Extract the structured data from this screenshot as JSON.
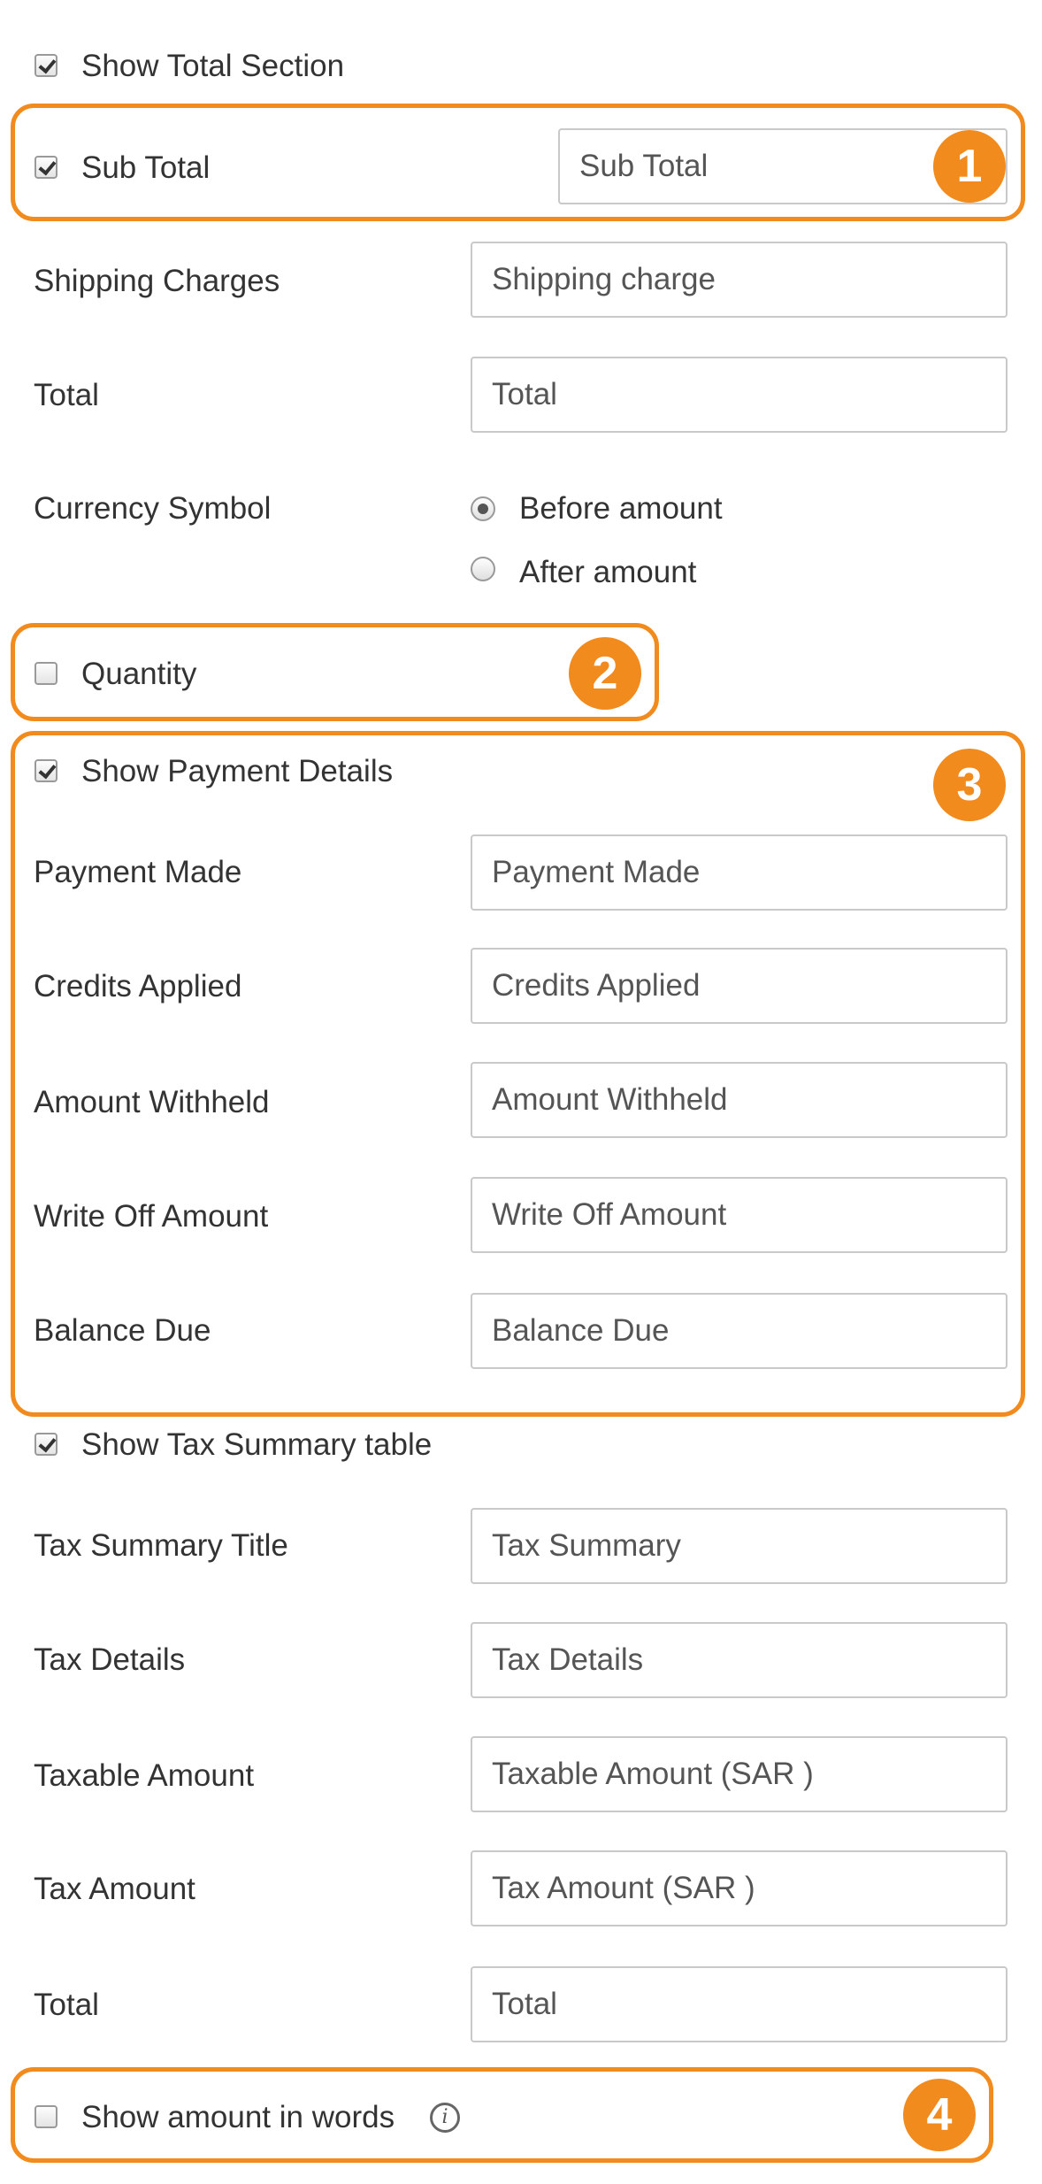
{
  "total_section": {
    "show_total_label": "Show Total Section",
    "show_total_checked": true,
    "sub_total": {
      "label": "Sub Total",
      "checked": true,
      "value": "Sub Total"
    },
    "shipping": {
      "label": "Shipping Charges",
      "value": "Shipping charge"
    },
    "total": {
      "label": "Total",
      "value": "Total"
    },
    "currency": {
      "label": "Currency Symbol",
      "options": [
        "Before amount",
        "After amount"
      ],
      "selected": "Before amount"
    },
    "quantity": {
      "label": "Quantity",
      "checked": false
    }
  },
  "payment_details": {
    "label": "Show Payment Details",
    "checked": true,
    "fields": [
      {
        "label": "Payment Made",
        "value": "Payment Made"
      },
      {
        "label": "Credits Applied",
        "value": "Credits Applied"
      },
      {
        "label": "Amount Withheld",
        "value": "Amount Withheld"
      },
      {
        "label": "Write Off Amount",
        "value": "Write Off Amount"
      },
      {
        "label": "Balance Due",
        "value": "Balance Due"
      }
    ]
  },
  "tax_summary": {
    "label": "Show Tax Summary table",
    "checked": true,
    "fields": [
      {
        "label": "Tax Summary Title",
        "value": "Tax Summary"
      },
      {
        "label": "Tax Details",
        "value": "Tax Details"
      },
      {
        "label": "Taxable Amount",
        "value": "Taxable Amount (SAR )"
      },
      {
        "label": "Tax Amount",
        "value": "Tax Amount (SAR )"
      },
      {
        "label": "Total",
        "value": "Total"
      }
    ]
  },
  "amount_in_words": {
    "label": "Show amount in words",
    "checked": false,
    "info_icon": "info-icon"
  },
  "callouts": [
    "1",
    "2",
    "3",
    "4"
  ],
  "colors": {
    "accent": "#f28b1e",
    "border": "#c9c9c9",
    "text": "#333333"
  }
}
